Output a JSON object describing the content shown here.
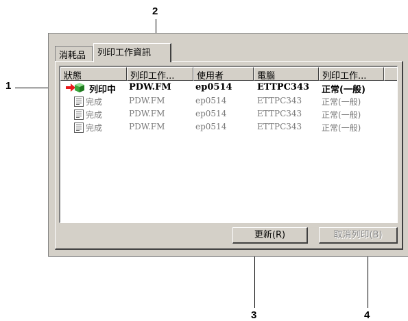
{
  "callouts": {
    "c1": "1",
    "c2": "2",
    "c3": "3",
    "c4": "4"
  },
  "tabs": {
    "consumables": "消耗品",
    "job_info": "列印工作資訊"
  },
  "columns": [
    "狀態",
    "列印工作...",
    "使用者",
    "電腦",
    "列印工作..."
  ],
  "rows": [
    {
      "status": "列印中",
      "job": "PDW.FM",
      "user": "ep0514",
      "computer": "ETTPC343",
      "type": "正常(一般)",
      "state": "active"
    },
    {
      "status": "完成",
      "job": "PDW.FM",
      "user": "ep0514",
      "computer": "ETTPC343",
      "type": "正常(一般)",
      "state": "done"
    },
    {
      "status": "完成",
      "job": "PDW.FM",
      "user": "ep0514",
      "computer": "ETTPC343",
      "type": "正常(一般)",
      "state": "done"
    },
    {
      "status": "完成",
      "job": "PDW.FM",
      "user": "ep0514",
      "computer": "ETTPC343",
      "type": "正常(一般)",
      "state": "done"
    }
  ],
  "buttons": {
    "refresh": "更新(R)",
    "cancel_print": "取消列印(B)"
  },
  "colors": {
    "dialog_bg": "#d4d0c8",
    "arrow": "#e8191b",
    "cube": "#3aa63a",
    "disabled_text": "#8a8a8a"
  },
  "icons": {
    "printing": [
      "arrow-icon",
      "cube-icon"
    ],
    "done": "document-icon"
  }
}
